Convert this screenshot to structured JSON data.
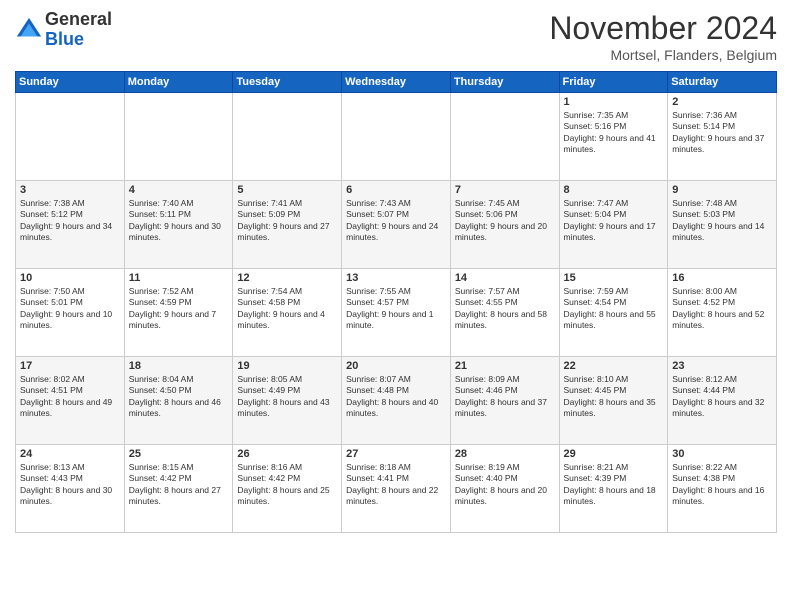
{
  "header": {
    "logo": {
      "line1": "General",
      "line2": "Blue"
    },
    "title": "November 2024",
    "location": "Mortsel, Flanders, Belgium"
  },
  "days_of_week": [
    "Sunday",
    "Monday",
    "Tuesday",
    "Wednesday",
    "Thursday",
    "Friday",
    "Saturday"
  ],
  "weeks": [
    [
      {
        "day": "",
        "info": ""
      },
      {
        "day": "",
        "info": ""
      },
      {
        "day": "",
        "info": ""
      },
      {
        "day": "",
        "info": ""
      },
      {
        "day": "",
        "info": ""
      },
      {
        "day": "1",
        "info": "Sunrise: 7:35 AM\nSunset: 5:16 PM\nDaylight: 9 hours and 41 minutes."
      },
      {
        "day": "2",
        "info": "Sunrise: 7:36 AM\nSunset: 5:14 PM\nDaylight: 9 hours and 37 minutes."
      }
    ],
    [
      {
        "day": "3",
        "info": "Sunrise: 7:38 AM\nSunset: 5:12 PM\nDaylight: 9 hours and 34 minutes."
      },
      {
        "day": "4",
        "info": "Sunrise: 7:40 AM\nSunset: 5:11 PM\nDaylight: 9 hours and 30 minutes."
      },
      {
        "day": "5",
        "info": "Sunrise: 7:41 AM\nSunset: 5:09 PM\nDaylight: 9 hours and 27 minutes."
      },
      {
        "day": "6",
        "info": "Sunrise: 7:43 AM\nSunset: 5:07 PM\nDaylight: 9 hours and 24 minutes."
      },
      {
        "day": "7",
        "info": "Sunrise: 7:45 AM\nSunset: 5:06 PM\nDaylight: 9 hours and 20 minutes."
      },
      {
        "day": "8",
        "info": "Sunrise: 7:47 AM\nSunset: 5:04 PM\nDaylight: 9 hours and 17 minutes."
      },
      {
        "day": "9",
        "info": "Sunrise: 7:48 AM\nSunset: 5:03 PM\nDaylight: 9 hours and 14 minutes."
      }
    ],
    [
      {
        "day": "10",
        "info": "Sunrise: 7:50 AM\nSunset: 5:01 PM\nDaylight: 9 hours and 10 minutes."
      },
      {
        "day": "11",
        "info": "Sunrise: 7:52 AM\nSunset: 4:59 PM\nDaylight: 9 hours and 7 minutes."
      },
      {
        "day": "12",
        "info": "Sunrise: 7:54 AM\nSunset: 4:58 PM\nDaylight: 9 hours and 4 minutes."
      },
      {
        "day": "13",
        "info": "Sunrise: 7:55 AM\nSunset: 4:57 PM\nDaylight: 9 hours and 1 minute."
      },
      {
        "day": "14",
        "info": "Sunrise: 7:57 AM\nSunset: 4:55 PM\nDaylight: 8 hours and 58 minutes."
      },
      {
        "day": "15",
        "info": "Sunrise: 7:59 AM\nSunset: 4:54 PM\nDaylight: 8 hours and 55 minutes."
      },
      {
        "day": "16",
        "info": "Sunrise: 8:00 AM\nSunset: 4:52 PM\nDaylight: 8 hours and 52 minutes."
      }
    ],
    [
      {
        "day": "17",
        "info": "Sunrise: 8:02 AM\nSunset: 4:51 PM\nDaylight: 8 hours and 49 minutes."
      },
      {
        "day": "18",
        "info": "Sunrise: 8:04 AM\nSunset: 4:50 PM\nDaylight: 8 hours and 46 minutes."
      },
      {
        "day": "19",
        "info": "Sunrise: 8:05 AM\nSunset: 4:49 PM\nDaylight: 8 hours and 43 minutes."
      },
      {
        "day": "20",
        "info": "Sunrise: 8:07 AM\nSunset: 4:48 PM\nDaylight: 8 hours and 40 minutes."
      },
      {
        "day": "21",
        "info": "Sunrise: 8:09 AM\nSunset: 4:46 PM\nDaylight: 8 hours and 37 minutes."
      },
      {
        "day": "22",
        "info": "Sunrise: 8:10 AM\nSunset: 4:45 PM\nDaylight: 8 hours and 35 minutes."
      },
      {
        "day": "23",
        "info": "Sunrise: 8:12 AM\nSunset: 4:44 PM\nDaylight: 8 hours and 32 minutes."
      }
    ],
    [
      {
        "day": "24",
        "info": "Sunrise: 8:13 AM\nSunset: 4:43 PM\nDaylight: 8 hours and 30 minutes."
      },
      {
        "day": "25",
        "info": "Sunrise: 8:15 AM\nSunset: 4:42 PM\nDaylight: 8 hours and 27 minutes."
      },
      {
        "day": "26",
        "info": "Sunrise: 8:16 AM\nSunset: 4:42 PM\nDaylight: 8 hours and 25 minutes."
      },
      {
        "day": "27",
        "info": "Sunrise: 8:18 AM\nSunset: 4:41 PM\nDaylight: 8 hours and 22 minutes."
      },
      {
        "day": "28",
        "info": "Sunrise: 8:19 AM\nSunset: 4:40 PM\nDaylight: 8 hours and 20 minutes."
      },
      {
        "day": "29",
        "info": "Sunrise: 8:21 AM\nSunset: 4:39 PM\nDaylight: 8 hours and 18 minutes."
      },
      {
        "day": "30",
        "info": "Sunrise: 8:22 AM\nSunset: 4:38 PM\nDaylight: 8 hours and 16 minutes."
      }
    ]
  ]
}
